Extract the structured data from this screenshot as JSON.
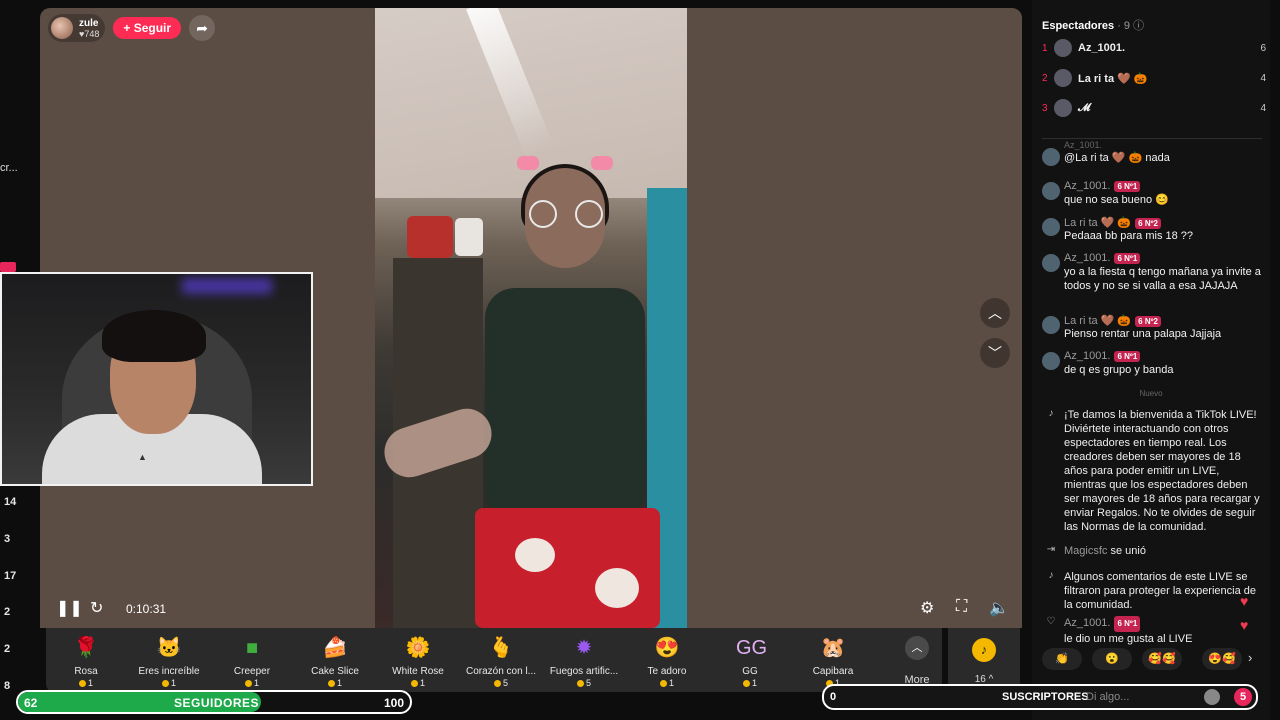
{
  "left_strip": {
    "fragment": "cr...",
    "numbers": [
      "14",
      "3",
      "17",
      "2",
      "2",
      "8"
    ]
  },
  "streamer": {
    "name": "zule",
    "likes": "♥748",
    "follow_label": "+ Seguir"
  },
  "player": {
    "time": "0:10:31"
  },
  "gifts": [
    {
      "name": "Rosa",
      "price": "1",
      "icon": "rose-icon",
      "glyph": "🌹",
      "color": "#e03a4a"
    },
    {
      "name": "Eres increíble",
      "price": "1",
      "icon": "cat-icon",
      "glyph": "🐱",
      "color": "#c99a7a"
    },
    {
      "name": "Creeper",
      "price": "1",
      "icon": "creeper-icon",
      "glyph": "■",
      "color": "#3fae3f"
    },
    {
      "name": "Cake Slice",
      "price": "1",
      "icon": "cake-icon",
      "glyph": "🍰",
      "color": "#e98a5a"
    },
    {
      "name": "White Rose",
      "price": "1",
      "icon": "white-rose-icon",
      "glyph": "🌼",
      "color": "#e8e8e8"
    },
    {
      "name": "Corazón con l...",
      "price": "5",
      "icon": "heart-hand-icon",
      "glyph": "🫰",
      "color": "#f0a080"
    },
    {
      "name": "Fuegos artific...",
      "price": "5",
      "icon": "fireworks-icon",
      "glyph": "✹",
      "color": "#9a5af0"
    },
    {
      "name": "Te adoro",
      "price": "1",
      "icon": "love-face-icon",
      "glyph": "😍",
      "color": "#f06030"
    },
    {
      "name": "GG",
      "price": "1",
      "icon": "gg-icon",
      "glyph": "GG",
      "color": "#e0b0f0"
    },
    {
      "name": "Capibara",
      "price": "1",
      "icon": "capybara-icon",
      "glyph": "🐹",
      "color": "#a0704a"
    }
  ],
  "more_label": "More",
  "coins_value": "16 ^",
  "followers_bar": {
    "current": "62",
    "label": "SEGUIDORES",
    "goal": "100",
    "progress": 0.62
  },
  "subs_bar": {
    "current": "0",
    "label": "SUSCRIPTORES",
    "placeholder": "Di algo...",
    "count": "5"
  },
  "panel": {
    "title": "Espectadores",
    "count": " · 9",
    "ranks": [
      {
        "n": "1",
        "name": "Az_1001.",
        "score": "6"
      },
      {
        "n": "2",
        "name": "La ri ta 🤎 🎃",
        "score": "4"
      },
      {
        "n": "3",
        "name": "𝓜",
        "score": "4"
      }
    ],
    "comments": [
      {
        "user": "Az_1001.",
        "badge": "",
        "text": "@La ri ta 🤎 🎃 nada"
      },
      {
        "user": "Az_1001.",
        "badge": "6 Nº1",
        "text": "que no sea bueno 😊"
      },
      {
        "user": "La ri ta 🤎 🎃",
        "badge": "6 Nº2",
        "text": "Pedaaa bb para mis 18 ??"
      },
      {
        "user": "Az_1001.",
        "badge": "6 Nº1",
        "text": "yo a la fiesta q tengo mañana ya invite a todos y no se si valla a esa JAJAJA"
      },
      {
        "user": "La ri ta 🤎 🎃",
        "badge": "6 Nº2",
        "text": "Pienso rentar una palapa Jajjaja"
      },
      {
        "user": "Az_1001.",
        "badge": "6 Nº1",
        "text": "de q es grupo y banda"
      }
    ],
    "nuevo": "Nuevo",
    "welcome": "¡Te damos la bienvenida a TikTok LIVE! Diviértete interactuando con otros espectadores en tiempo real. Los creadores deben ser mayores de 18 años para poder emitir un LIVE, mientras que los espectadores deben ser mayores de 18 años para recargar y enviar Regalos. No te olvides de seguir las Normas de la comunidad.",
    "joined_user": "Magicsfc",
    "joined_text": "se unió",
    "filtered": "Algunos comentarios de este LIVE se filtraron para proteger la experiencia de la comunidad.",
    "like_user": "Az_1001.",
    "like_badge": "6 Nº1",
    "like_text": "le dio un me gusta al LIVE",
    "emojis": [
      "👏",
      "😮",
      "🥰🥰",
      "😍🥰"
    ]
  }
}
